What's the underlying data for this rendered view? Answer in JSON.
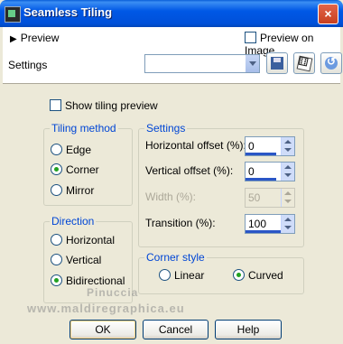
{
  "window": {
    "title": "Seamless Tiling",
    "close_glyph": "×"
  },
  "header": {
    "preview_arrow": "▶",
    "preview_label": "Preview",
    "preview_on_image_label": "Preview on Image",
    "preview_on_image_checked": false,
    "settings_label": "Settings",
    "settings_value": ""
  },
  "toolbar_icons": [
    "save-icon",
    "dice-icon",
    "reset-icon"
  ],
  "show_tiling_preview": {
    "label": "Show tiling preview",
    "checked": false
  },
  "tiling_method": {
    "title": "Tiling method",
    "options": [
      {
        "label": "Edge",
        "selected": false
      },
      {
        "label": "Corner",
        "selected": true
      },
      {
        "label": "Mirror",
        "selected": false
      }
    ]
  },
  "direction": {
    "title": "Direction",
    "options": [
      {
        "label": "Horizontal",
        "selected": false
      },
      {
        "label": "Vertical",
        "selected": false
      },
      {
        "label": "Bidirectional",
        "selected": true
      }
    ]
  },
  "settings": {
    "title": "Settings",
    "fields": [
      {
        "label": "Horizontal offset (%):",
        "value": "0",
        "enabled": true
      },
      {
        "label": "Vertical offset (%):",
        "value": "0",
        "enabled": true
      },
      {
        "label": "Width (%):",
        "value": "50",
        "enabled": false
      },
      {
        "label": "Transition (%):",
        "value": "100",
        "enabled": true
      }
    ]
  },
  "corner_style": {
    "title": "Corner style",
    "options": [
      {
        "label": "Linear",
        "selected": false
      },
      {
        "label": "Curved",
        "selected": true
      }
    ]
  },
  "watermark": {
    "line1": "Pinuccia",
    "line2": "www.maldiregraphica.eu"
  },
  "buttons": {
    "ok": "OK",
    "cancel": "Cancel",
    "help": "Help"
  }
}
